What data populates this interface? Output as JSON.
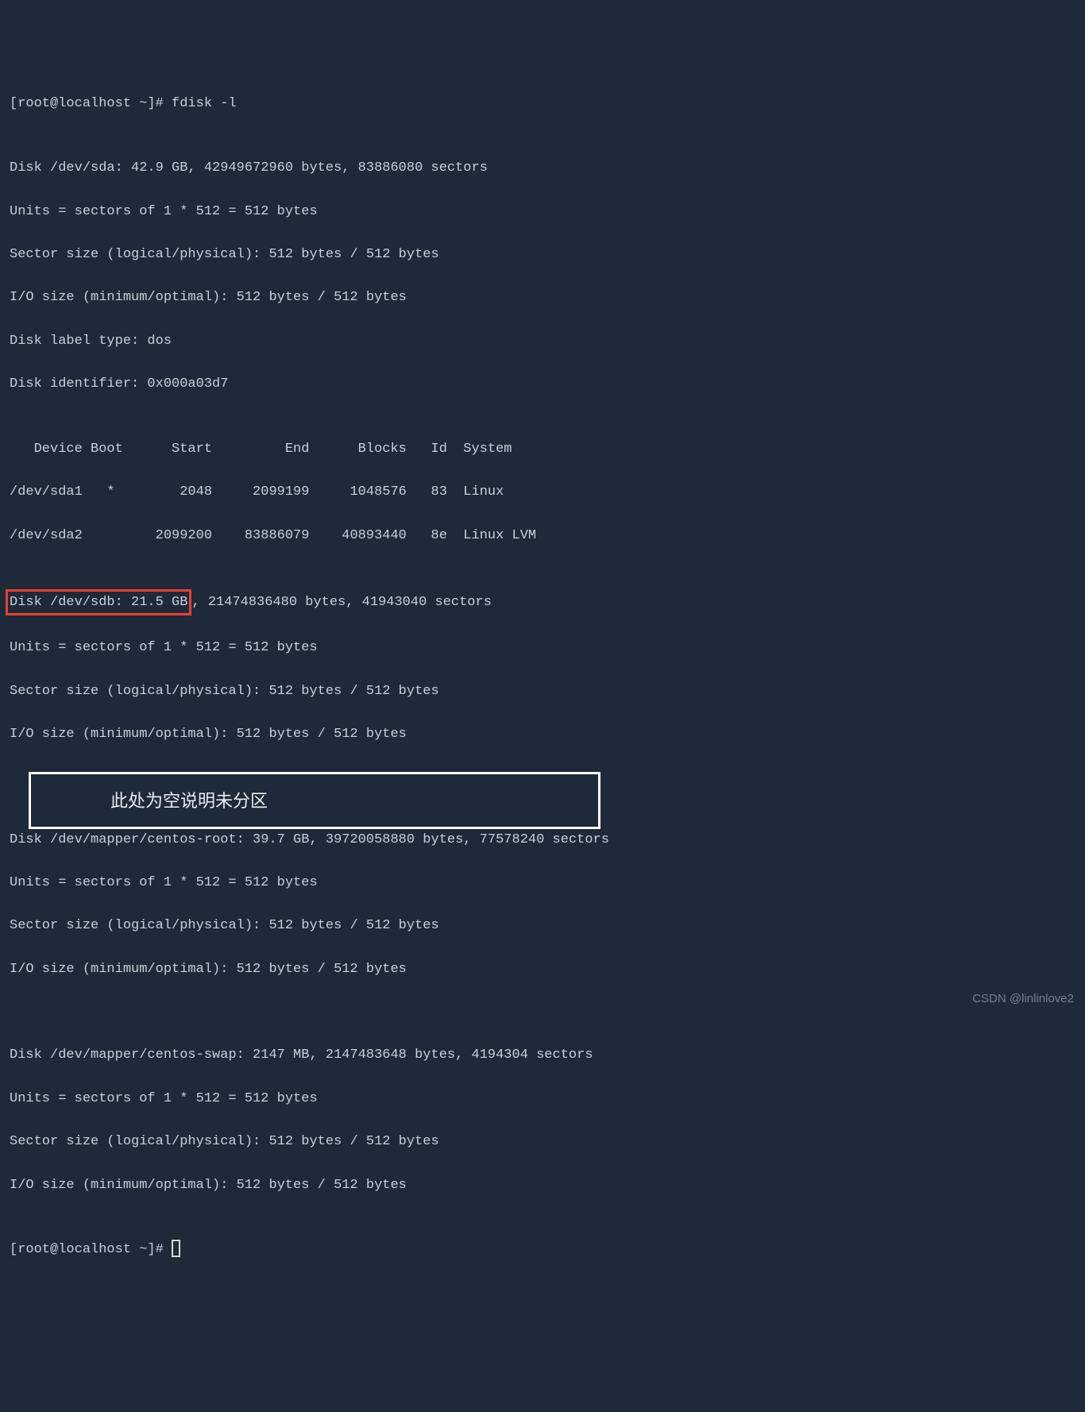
{
  "prompt1": "[root@localhost ~]# fdisk -l",
  "blank": "",
  "sda": {
    "header": "Disk /dev/sda: 42.9 GB, 42949672960 bytes, 83886080 sectors",
    "units": "Units = sectors of 1 * 512 = 512 bytes",
    "sector": "Sector size (logical/physical): 512 bytes / 512 bytes",
    "io": "I/O size (minimum/optimal): 512 bytes / 512 bytes",
    "label": "Disk label type: dos",
    "ident": "Disk identifier: 0x000a03d7"
  },
  "pt_header": "   Device Boot      Start         End      Blocks   Id  System",
  "pt_row1": "/dev/sda1   *        2048     2099199     1048576   83  Linux",
  "pt_row2": "/dev/sda2         2099200    83886079    40893440   8e  Linux LVM",
  "sdb": {
    "header_marked": "Disk /dev/sdb: 21.5 GB",
    "header_rest": ", 21474836480 bytes, 41943040 sectors",
    "units": "Units = sectors of 1 * 512 = 512 bytes",
    "sector": "Sector size (logical/physical): 512 bytes / 512 bytes",
    "io": "I/O size (minimum/optimal): 512 bytes / 512 bytes"
  },
  "annotation": "此处为空说明未分区",
  "root": {
    "header": "Disk /dev/mapper/centos-root: 39.7 GB, 39720058880 bytes, 77578240 sectors",
    "units": "Units = sectors of 1 * 512 = 512 bytes",
    "sector": "Sector size (logical/physical): 512 bytes / 512 bytes",
    "io": "I/O size (minimum/optimal): 512 bytes / 512 bytes"
  },
  "swap": {
    "header": "Disk /dev/mapper/centos-swap: 2147 MB, 2147483648 bytes, 4194304 sectors",
    "units": "Units = sectors of 1 * 512 = 512 bytes",
    "sector": "Sector size (logical/physical): 512 bytes / 512 bytes",
    "io": "I/O size (minimum/optimal): 512 bytes / 512 bytes"
  },
  "prompt2": "[root@localhost ~]# ",
  "watermark": "CSDN @linlinlove2"
}
